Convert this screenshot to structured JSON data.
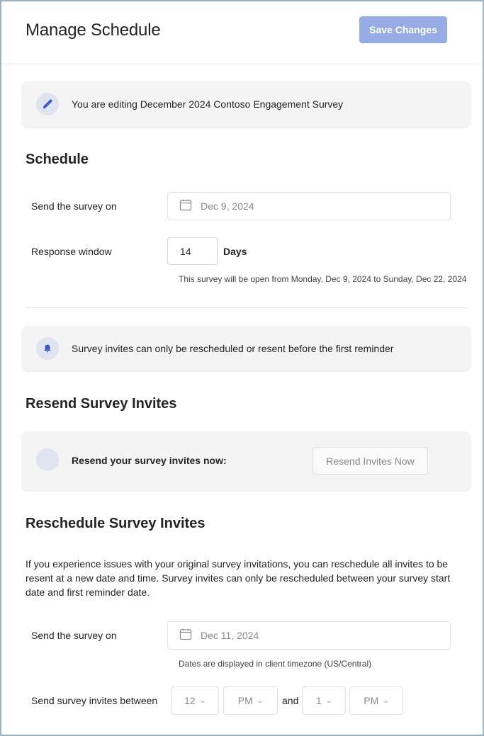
{
  "header": {
    "title": "Manage Schedule",
    "save_label": "Save Changes"
  },
  "editing_banner": {
    "icon": "pencil-icon",
    "text": "You are editing December 2024 Contoso Engagement Survey"
  },
  "schedule": {
    "title": "Schedule",
    "send_label": "Send the survey on",
    "send_date": "Dec 9, 2024",
    "response_label": "Response window",
    "response_value": "14",
    "response_unit": "Days",
    "open_hint": "This survey will be open from Monday, Dec 9, 2024 to Sunday, Dec 22, 2024"
  },
  "reminder_banner": {
    "icon": "bell-icon",
    "text": "Survey invites can only be rescheduled or resent before the first reminder"
  },
  "resend": {
    "title": "Resend Survey Invites",
    "text": "Resend your survey invites now:",
    "button_label": "Resend Invites Now"
  },
  "reschedule": {
    "title": "Reschedule Survey Invites",
    "description": "If you experience issues with your original survey invitations, you can reschedule all invites to be resent at a new date and time. Survey invites can only be rescheduled between your survey start date and first reminder date.",
    "send_label": "Send the survey on",
    "send_date": "Dec 11, 2024",
    "timezone_hint": "Dates are displayed in client timezone (US/Central)",
    "between_label": "Send survey invites between",
    "start_hour": "12",
    "start_period": "PM",
    "and_label": "and",
    "end_hour": "1",
    "end_period": "PM"
  },
  "colors": {
    "accent": "#3a5ccc",
    "save_button_disabled": "#97ace4"
  }
}
